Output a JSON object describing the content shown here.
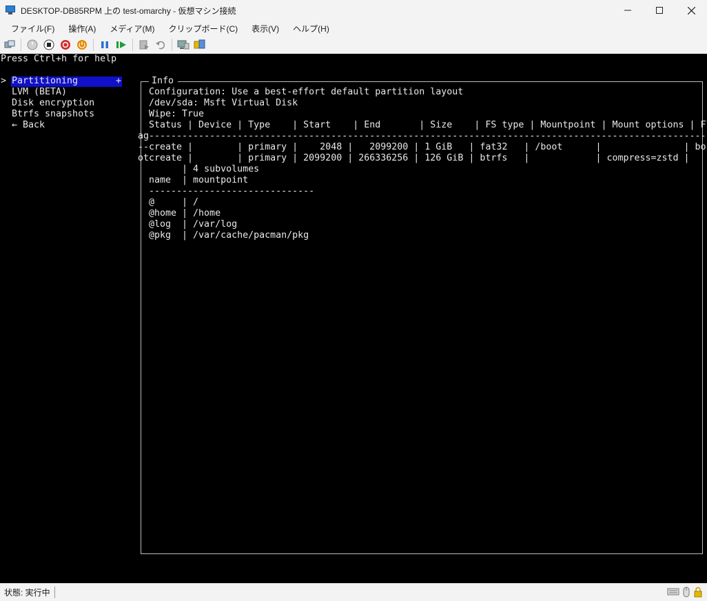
{
  "window": {
    "title": "DESKTOP-DB85RPM 上の test-omarchy  - 仮想マシン接続",
    "controls": [
      "minimize-icon",
      "maximize-icon",
      "close-icon"
    ]
  },
  "menubar": {
    "items": [
      {
        "label": "ファイル(F)"
      },
      {
        "label": "操作(A)"
      },
      {
        "label": "メディア(M)"
      },
      {
        "label": "クリップボード(C)"
      },
      {
        "label": "表示(V)"
      },
      {
        "label": "ヘルプ(H)"
      }
    ]
  },
  "toolbar": {
    "icons": [
      "ctrl-alt-del-icon",
      "start-icon",
      "turn-off-icon",
      "shut-down-icon",
      "save-icon",
      "pause-icon",
      "reset-icon",
      "checkpoint-icon",
      "revert-icon",
      "enhanced-session-icon",
      "share-icon"
    ],
    "colors": {
      "red": "#d42b2b",
      "orange": "#e68a00",
      "blue": "#2a6fd6",
      "green": "#1e9e3a",
      "gray": "#8c8c8c"
    }
  },
  "terminal": {
    "help_text": "Press Ctrl+h for help",
    "menu": {
      "selected": {
        "cursor": ">",
        "label": "Partitioning",
        "plus": "+"
      },
      "items": [
        "LVM (BETA)",
        "Disk encryption",
        "Btrfs snapshots",
        "← Back"
      ]
    },
    "info": {
      "title": "Info",
      "configuration": "Configuration: Use a best-effort default partition layout",
      "device": "/dev/sda: Msft Virtual Disk",
      "wipe": "Wipe: True",
      "table_header": "Status | Device | Type    | Start    | End       | Size    | FS type | Mountpoint | Mount options | Fl",
      "table_divider": "ag--------------------------------------------------------------------------------------------------------------------------------",
      "rows": [
        "--create |        | primary |    2048 |   2099200 | 1 GiB   | fat32   | /boot      |               | bo",
        "otcreate |        | primary | 2099200 | 266336256 | 126 GiB | btrfs   |            | compress=zstd |   "
      ],
      "subvolumes_line": "        | 4 subvolumes",
      "sub_header": "name  | mountpoint",
      "sub_divider": "------------------------------",
      "subvolumes": [
        "@     | /",
        "@home | /home",
        "@log  | /var/log",
        "@pkg  | /var/cache/pacman/pkg"
      ]
    },
    "colors": {
      "background": "#000000",
      "text": "#e8e8e8",
      "selection": "#1010c8"
    }
  },
  "statusbar": {
    "text": "状態: 実行中",
    "icons": [
      "keyboard-icon",
      "mouse-icon",
      "lock-icon"
    ]
  }
}
